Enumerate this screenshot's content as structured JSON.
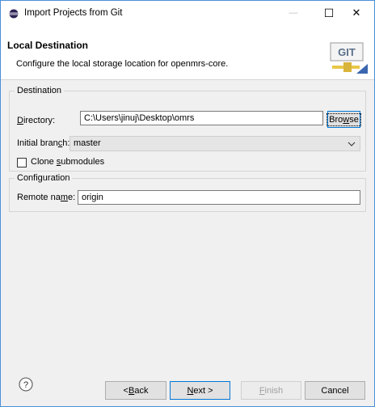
{
  "window": {
    "title": "Import Projects from Git",
    "minimize_glyph": "—",
    "maximize_glyph": "☐",
    "close_glyph": "✕"
  },
  "banner": {
    "title": "Local Destination",
    "description": "Configure the local storage location for openmrs-core.",
    "logo_text": "GIT"
  },
  "destination": {
    "legend": "Destination",
    "directory_label_prefix": "",
    "directory_label_access": "D",
    "directory_label_rest": "irectory:",
    "directory_value": "C:\\Users\\jinuj\\Desktop\\omrs",
    "browse_prefix": "Bro",
    "browse_access": "w",
    "browse_rest": "se",
    "branch_label_prefix": "Initial bran",
    "branch_label_access": "c",
    "branch_label_rest": "h:",
    "branch_value": "master",
    "clone_label_prefix": "Clone ",
    "clone_label_access": "s",
    "clone_label_rest": "ubmodules",
    "clone_checked": false
  },
  "configuration": {
    "legend": "Configuration",
    "remote_label_prefix": "Remote na",
    "remote_label_access": "m",
    "remote_label_rest": "e:",
    "remote_value": "origin"
  },
  "footer": {
    "help_glyph": "?",
    "back_prefix": "< ",
    "back_access": "B",
    "back_rest": "ack",
    "next_access": "N",
    "next_rest": "ext >",
    "finish_access": "F",
    "finish_rest": "inish",
    "cancel_label": "Cancel"
  },
  "colors": {
    "window_border": "#4a90d9",
    "focus_blue": "#0078d7",
    "git_orange": "#e87a1e"
  }
}
